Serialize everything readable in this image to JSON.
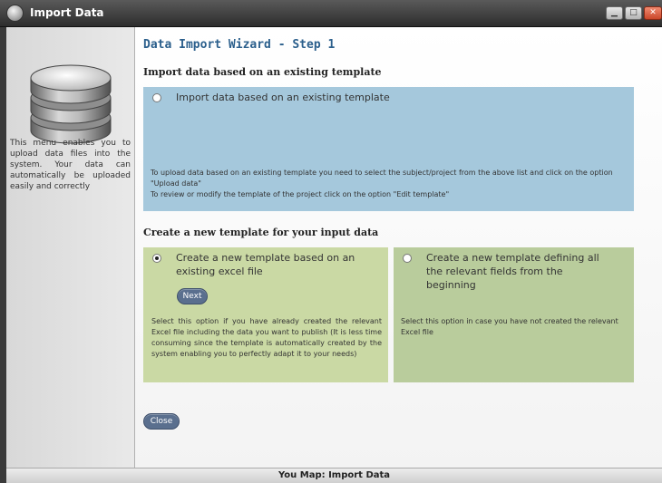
{
  "window": {
    "title": "Import Data",
    "icon": "database-icon",
    "controls": {
      "minimize": "minimize-icon",
      "maximize": "maximize-icon",
      "close": "close-icon"
    }
  },
  "sidebar": {
    "icon": "database-icon",
    "text": "This menu enables you to upload data files into the system. Your data can automatically be uploaded easily and correctly"
  },
  "main": {
    "wizard_title": "Data Import Wizard - Step 1",
    "existing_template": {
      "heading": "Import data based on an existing template",
      "option_label": "Import data based on an existing template",
      "selected": false,
      "description_line1": "To upload data based on an existing template you need to select the subject/project from the above list and click on the option \"Upload data\"",
      "description_line2": "To review or modify the template of the project click on the option \"Edit template\""
    },
    "new_template": {
      "heading": "Create a new template for your input data",
      "option_excel": {
        "label": "Create a new template based on an existing excel file",
        "selected": true,
        "button": "Next",
        "description": "Select this option if you have already created the relevant Excel file including the data you want to publish (It is less time consuming since the template is automatically created by the system enabling you to perfectly adapt it to your needs)"
      },
      "option_manual": {
        "label": "Create a new template defining all the relevant fields from the beginning",
        "selected": false,
        "description": "Select this option in case you have not created the relevant Excel file"
      }
    },
    "close_button": "Close"
  },
  "status_bar": {
    "text": "You Map: Import Data"
  },
  "colors": {
    "titlebar": "#3a3a3a",
    "wizard_title": "#2b5f8c",
    "blue_panel": "#a5c8dc",
    "green_left": "#cad9a4",
    "green_right": "#b9cc9c",
    "button": "#5a6f8e"
  }
}
